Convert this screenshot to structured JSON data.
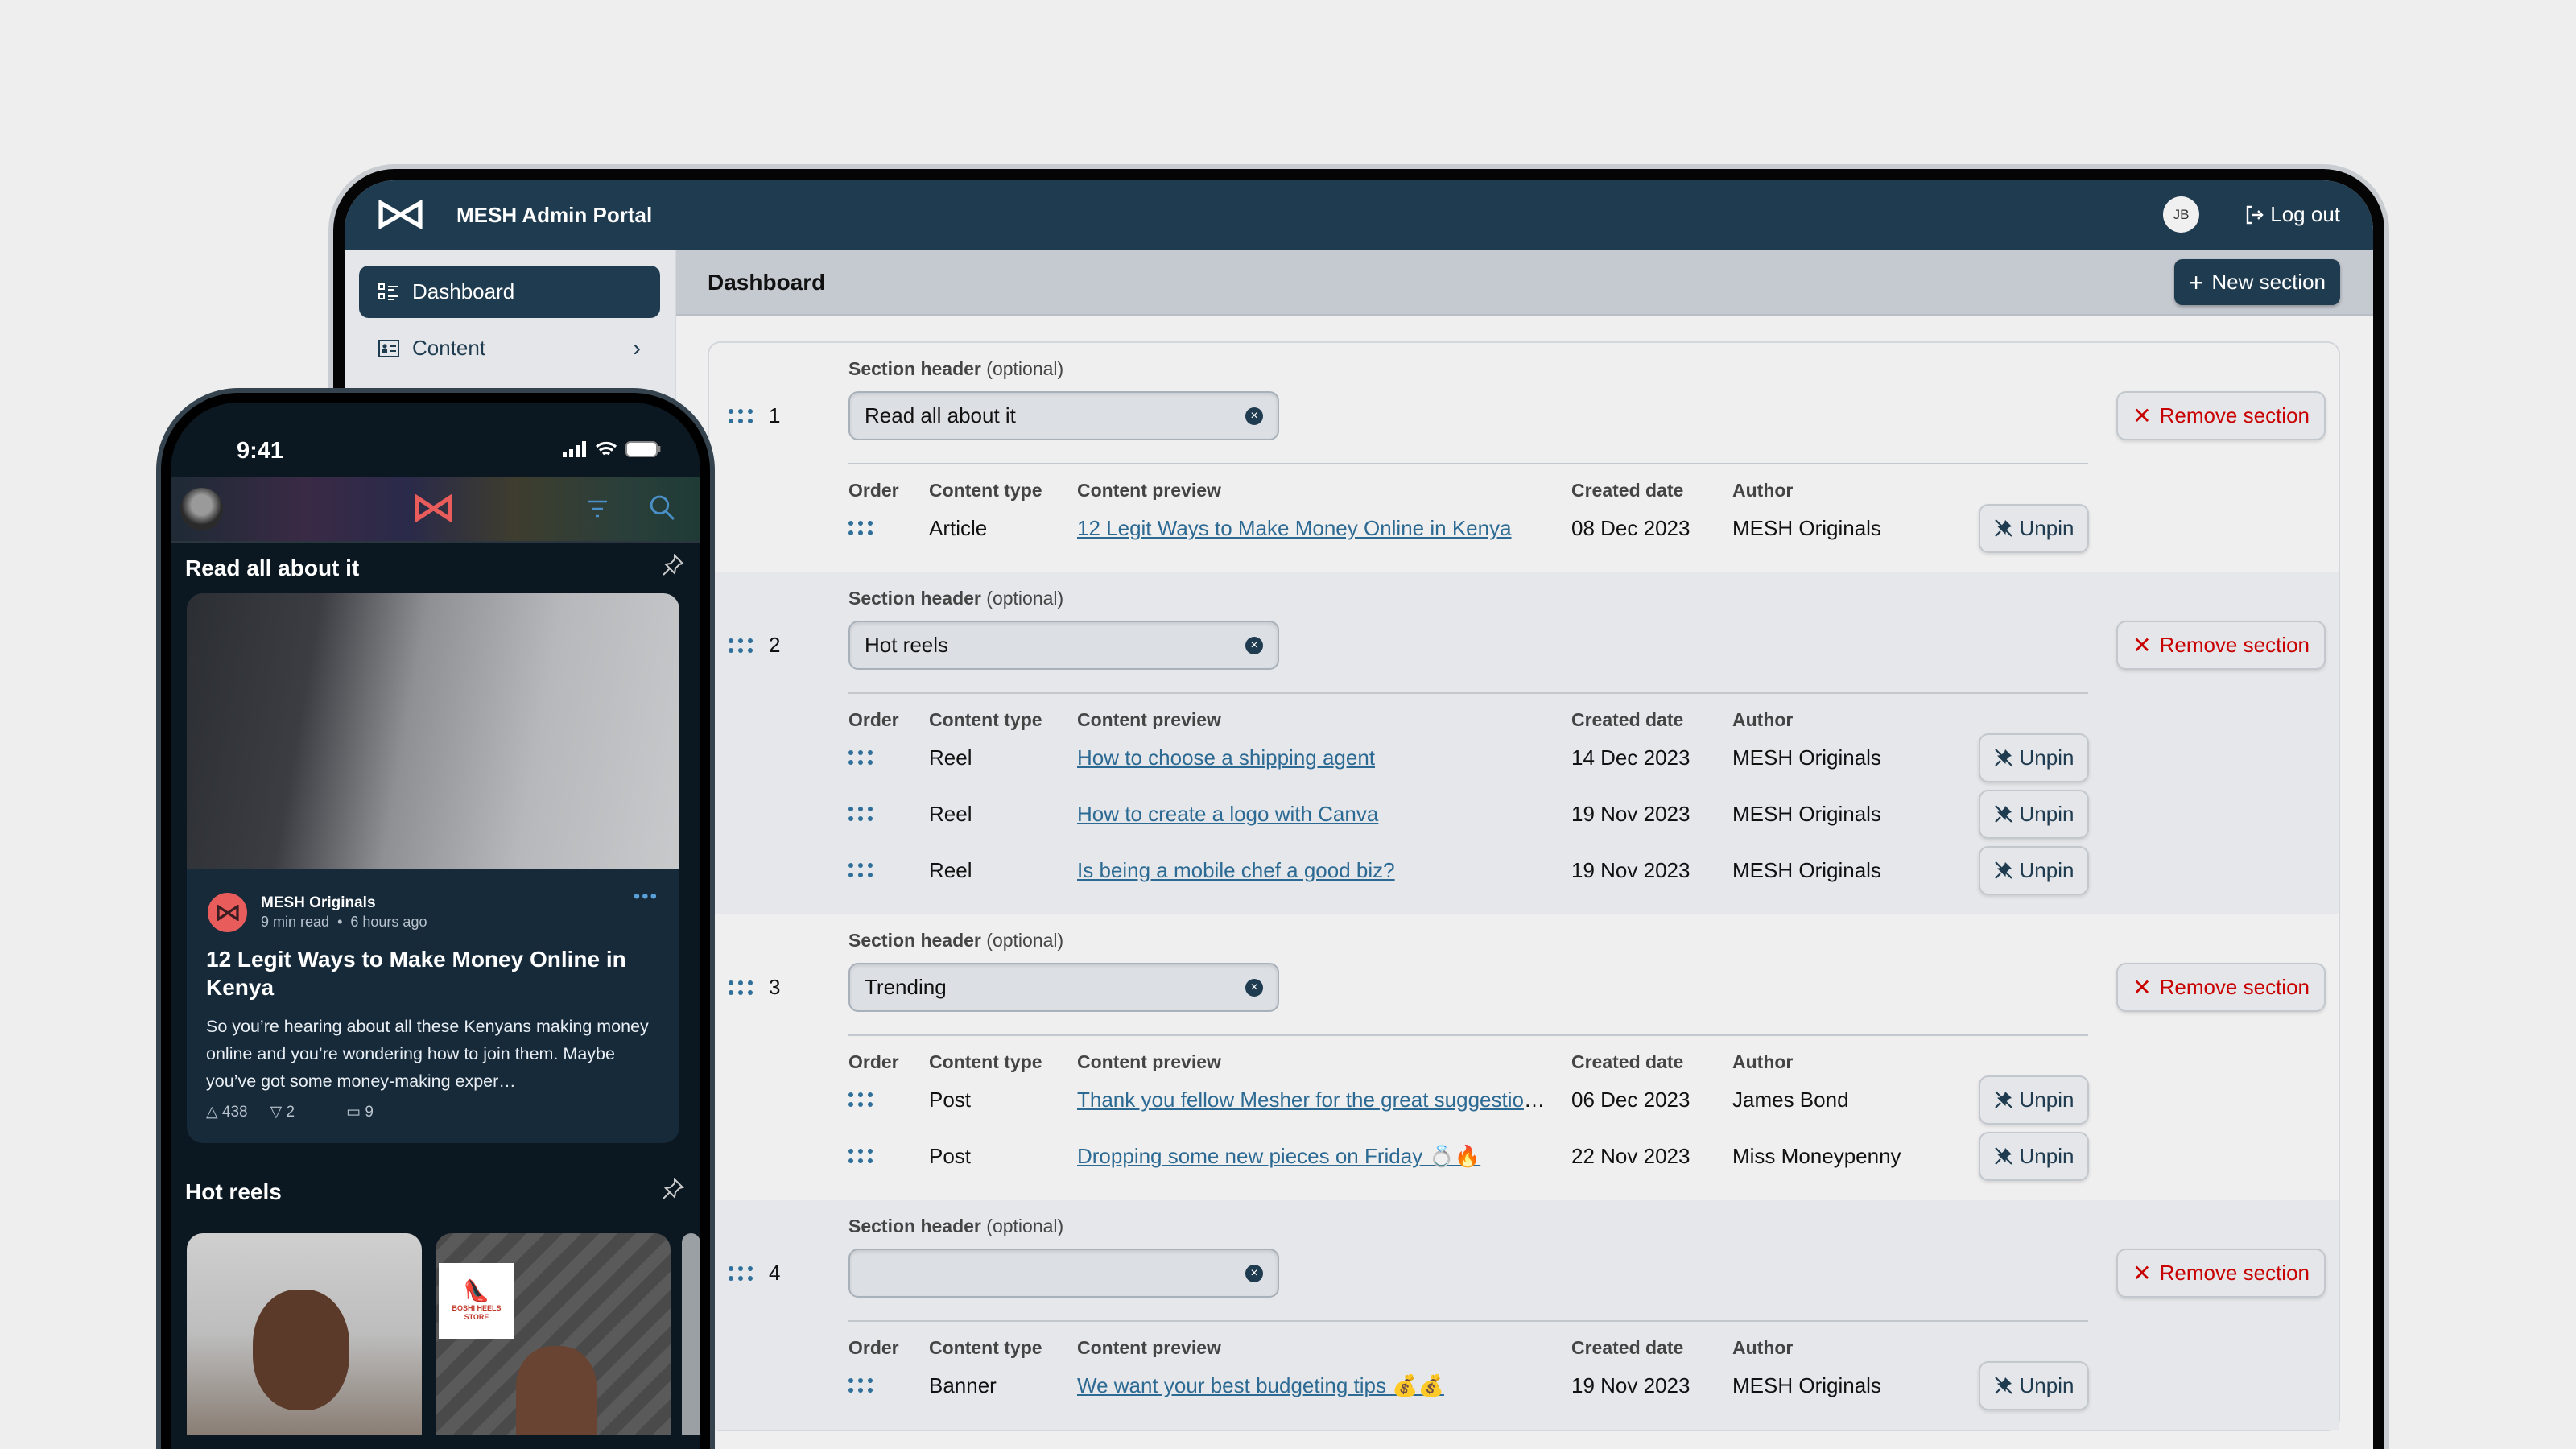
{
  "admin": {
    "app_title": "MESH Admin Portal",
    "user_initials": "JB",
    "logout_label": "Log out",
    "sidebar": [
      {
        "label": "Dashboard",
        "icon": "list-icon",
        "active": true
      },
      {
        "label": "Content",
        "icon": "content-card-icon",
        "active": false
      }
    ],
    "page_title": "Dashboard",
    "new_section_label": "New section",
    "section_label": "Section header",
    "section_label_optional": "(optional)",
    "remove_label": "Remove section",
    "unpin_label": "Unpin",
    "columns": [
      "Order",
      "Content type",
      "Content preview",
      "Created date",
      "Author"
    ],
    "sections": [
      {
        "number": "1",
        "header": "Read all about it",
        "rows": [
          {
            "type": "Article",
            "preview": "12 Legit Ways to Make Money Online in Kenya",
            "created": "08 Dec 2023",
            "author": "MESH Originals"
          }
        ]
      },
      {
        "number": "2",
        "header": "Hot reels",
        "rows": [
          {
            "type": "Reel",
            "preview": "How to choose a shipping agent",
            "created": "14 Dec 2023",
            "author": "MESH Originals"
          },
          {
            "type": "Reel",
            "preview": "How to create a logo with Canva",
            "created": "19 Nov 2023",
            "author": "MESH Originals"
          },
          {
            "type": "Reel",
            "preview": "Is being a mobile chef a good biz?",
            "created": "19 Nov 2023",
            "author": "MESH Originals"
          }
        ]
      },
      {
        "number": "3",
        "header": "Trending",
        "rows": [
          {
            "type": "Post",
            "preview": "Thank you fellow Mesher for the great suggestions",
            "created": "06 Dec 2023",
            "author": "James Bond"
          },
          {
            "type": "Post",
            "preview": "Dropping some new pieces on Friday 💍🔥",
            "created": "22 Nov 2023",
            "author": "Miss Moneypenny"
          }
        ]
      },
      {
        "number": "4",
        "header": "",
        "rows": [
          {
            "type": "Banner",
            "preview": "We want your best budgeting tips 💰💰",
            "created": "19 Nov 2023",
            "author": "MESH Originals"
          }
        ]
      }
    ],
    "colors": {
      "brand": "#1f3b50",
      "danger": "#c80000",
      "link": "#2c6a93"
    }
  },
  "phone": {
    "time": "9:41",
    "section1_title": "Read all about it",
    "card": {
      "author": "MESH Originals",
      "read_time": "9 min read",
      "separator": "•",
      "posted": "6 hours ago",
      "title": "12 Legit Ways to Make Money Online in Kenya",
      "excerpt": "So you’re hearing about all these Kenyans making money online and you’re wondering how to join them. Maybe you’ve got some money-making exper…",
      "upvotes": "438",
      "downvotes": "2",
      "comments": "9"
    },
    "section2_title": "Hot reels",
    "reel_logo_text": "BOSHI HEELS STORE",
    "colors": {
      "logo": "#e85c5c"
    }
  }
}
